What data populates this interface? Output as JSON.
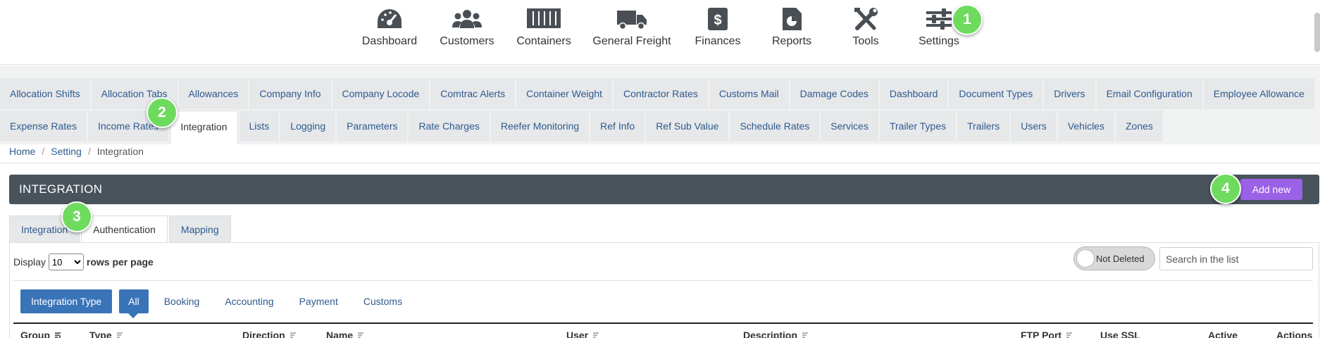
{
  "nav": {
    "items": [
      {
        "label": "Dashboard",
        "icon": "gauge-icon"
      },
      {
        "label": "Customers",
        "icon": "users-icon"
      },
      {
        "label": "Containers",
        "icon": "container-icon"
      },
      {
        "label": "General Freight",
        "icon": "truck-icon"
      },
      {
        "label": "Finances",
        "icon": "dollar-file-icon"
      },
      {
        "label": "Reports",
        "icon": "pie-file-icon"
      },
      {
        "label": "Tools",
        "icon": "tools-icon"
      },
      {
        "label": "Settings",
        "icon": "sliders-icon"
      }
    ]
  },
  "settings_tabs": {
    "row1": [
      "Allocation Shifts",
      "Allocation Tabs",
      "Allowances",
      "Company Info",
      "Company Locode",
      "Comtrac Alerts",
      "Container Weight",
      "Contractor Rates",
      "Customs Mail",
      "Damage Codes",
      "Dashboard",
      "Document Types",
      "Drivers",
      "Email Configuration",
      "Employee Allowance"
    ],
    "row2": [
      "Expense Rates",
      "Income Rates",
      "Integration",
      "Lists",
      "Logging",
      "Parameters",
      "Rate Charges",
      "Reefer Monitoring",
      "Ref Info",
      "Ref Sub Value",
      "Schedule Rates",
      "Services",
      "Trailer Types",
      "Trailers",
      "Users",
      "Vehicles",
      "Zones"
    ],
    "active": "Integration"
  },
  "breadcrumb": {
    "home": "Home",
    "setting": "Setting",
    "current": "Integration"
  },
  "panel": {
    "title": "INTEGRATION",
    "add_label": "Add new"
  },
  "inner_tabs": {
    "items": [
      "Integration",
      "Authentication",
      "Mapping"
    ],
    "active": "Authentication"
  },
  "list_controls": {
    "display_label": "Display",
    "rows_value": "10",
    "rows_suffix": "rows per page",
    "toggle_label": "Not Deleted",
    "search_placeholder": "Search in the list"
  },
  "filters": {
    "type_label": "Integration Type",
    "options": [
      "All",
      "Booking",
      "Accounting",
      "Payment",
      "Customs"
    ],
    "active": "All"
  },
  "table": {
    "columns": [
      "Group",
      "Type",
      "Direction",
      "Name",
      "User",
      "Description",
      "FTP Port",
      "Use SSL",
      "Active",
      "Actions"
    ]
  },
  "badges": [
    "1",
    "2",
    "3",
    "4"
  ],
  "colors": {
    "header_bar": "#48535c",
    "add_button": "#9a62e6",
    "primary": "#3a74b8",
    "link": "#2e5a8f",
    "badge": "#6edb5e"
  }
}
